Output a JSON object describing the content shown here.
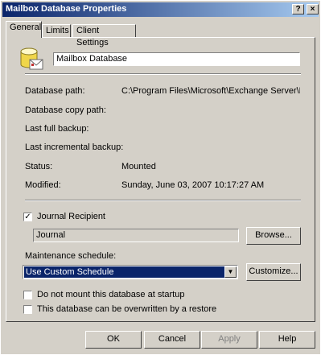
{
  "window": {
    "title": "Mailbox Database Properties",
    "help_glyph": "?",
    "close_glyph": "×"
  },
  "tabs": [
    {
      "label": "General",
      "active": true
    },
    {
      "label": "Limits",
      "active": false
    },
    {
      "label": "Client Settings",
      "active": false
    }
  ],
  "general": {
    "name_value": "Mailbox Database",
    "fields": [
      {
        "label": "Database path:",
        "value": "C:\\Program Files\\Microsoft\\Exchange Server\\Mailb"
      },
      {
        "label": "Database copy path:",
        "value": ""
      },
      {
        "label": "Last full backup:",
        "value": ""
      },
      {
        "label": "Last incremental backup:",
        "value": ""
      },
      {
        "label": "Status:",
        "value": "Mounted"
      },
      {
        "label": "Modified:",
        "value": "Sunday, June 03, 2007 10:17:27 AM"
      }
    ],
    "journal_recipient": {
      "label": "Journal Recipient",
      "checked": true,
      "check_glyph": "✓"
    },
    "journal_value": "Journal",
    "browse_label": "Browse...",
    "maintenance_label": "Maintenance schedule:",
    "maintenance_selected": "Use Custom Schedule",
    "dropdown_glyph": "▼",
    "customize_label": "Customize...",
    "no_mount": {
      "label": "Do not mount this database at startup",
      "checked": false
    },
    "overwrite": {
      "label": "This database can be overwritten by a restore",
      "checked": false
    }
  },
  "buttons": {
    "ok": "OK",
    "cancel": "Cancel",
    "apply": "Apply",
    "help": "Help"
  },
  "colors": {
    "titlebar_start": "#0a246a",
    "titlebar_end": "#a6caf0",
    "face": "#d4d0c8",
    "selection": "#0a246a"
  }
}
